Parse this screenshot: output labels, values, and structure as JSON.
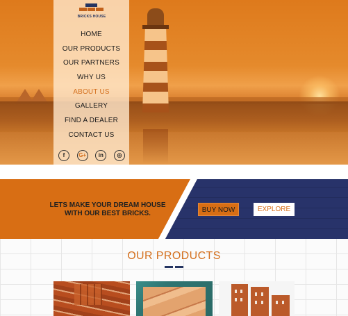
{
  "brand": {
    "logo_text": "BRICKS HOUSE",
    "accent": "#d86e14",
    "navy": "#28336a"
  },
  "nav": {
    "items": [
      {
        "label": "HOME",
        "active": false
      },
      {
        "label": "OUR PRODUCTS",
        "active": false
      },
      {
        "label": "OUR PARTNERS",
        "active": false
      },
      {
        "label": "WHY US",
        "active": false
      },
      {
        "label": "ABOUT US",
        "active": true
      },
      {
        "label": "GALLERY",
        "active": false
      },
      {
        "label": "FIND A DEALER",
        "active": false
      },
      {
        "label": "CONTACT US",
        "active": false
      }
    ],
    "socials": [
      {
        "icon": "facebook-icon",
        "glyph": "f"
      },
      {
        "icon": "google-plus-icon",
        "glyph": "G+"
      },
      {
        "icon": "linkedin-icon",
        "glyph": "in"
      },
      {
        "icon": "instagram-icon",
        "glyph": "◎"
      }
    ]
  },
  "banner": {
    "tagline_line1": "LETS MAKE YOUR DREAM HOUSE",
    "tagline_line2": "WITH OUR BEST BRICKS.",
    "buy_now": "BUY NOW",
    "explore": "EXPLORE"
  },
  "products": {
    "title": "OUR PRODUCTS"
  }
}
